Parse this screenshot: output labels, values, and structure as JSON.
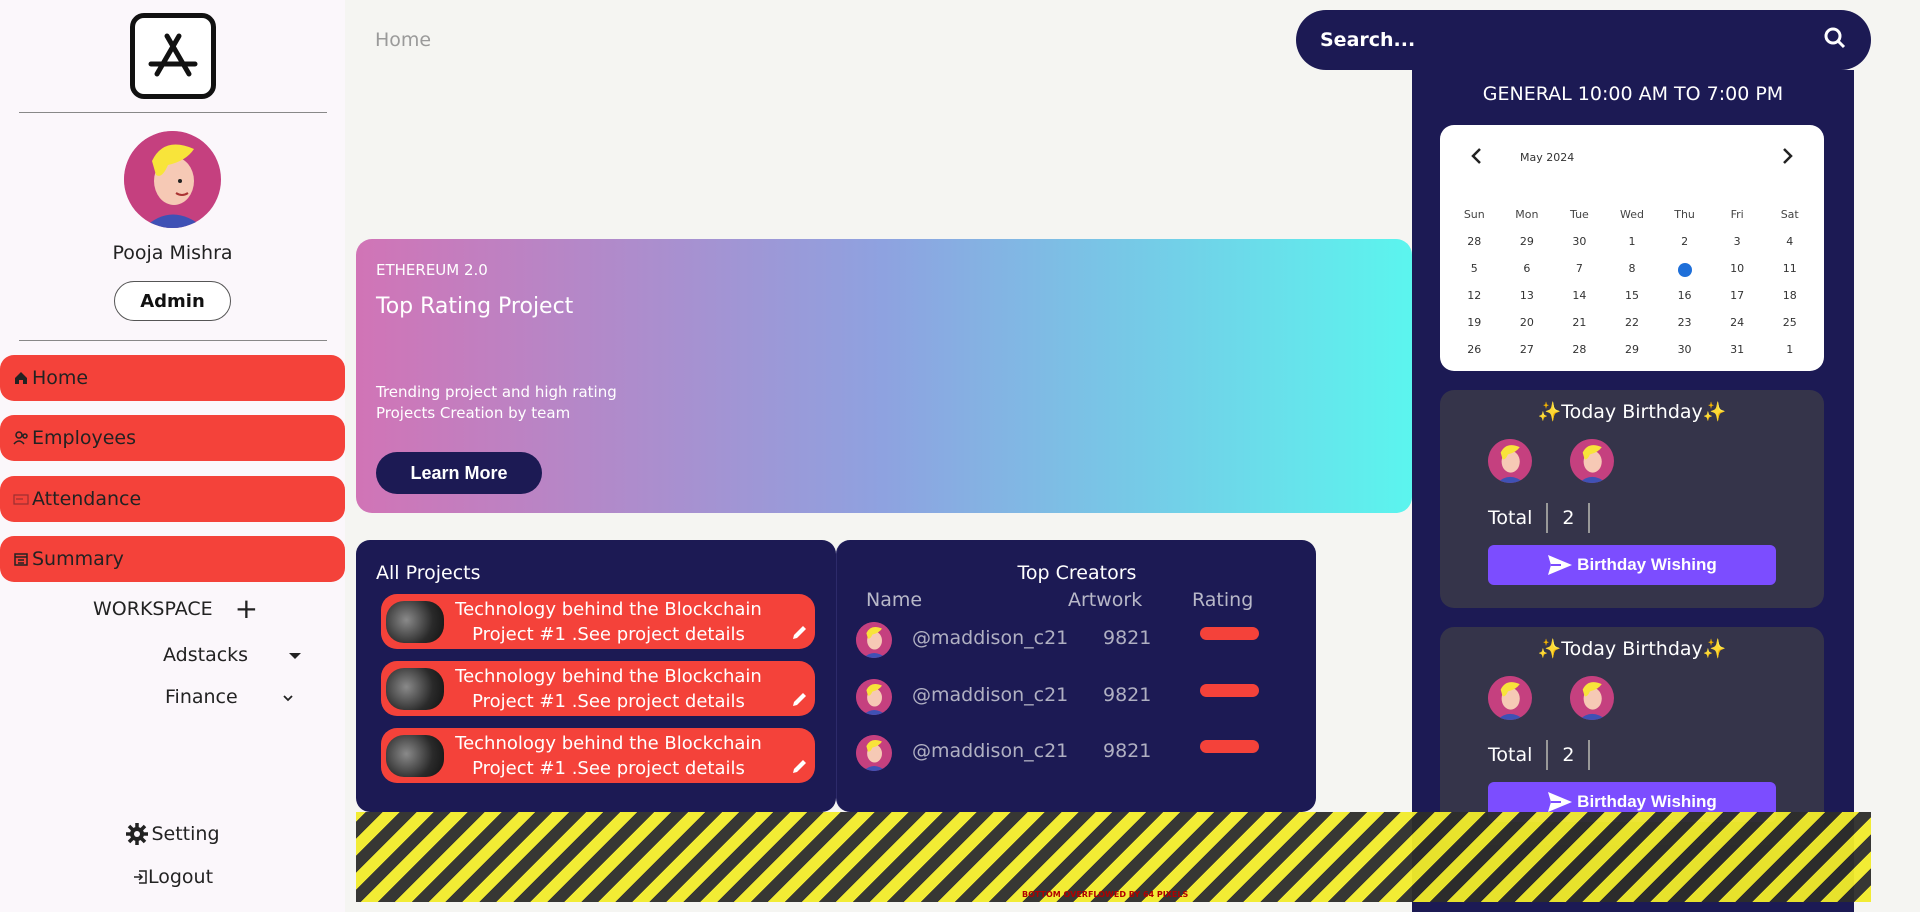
{
  "sidebar": {
    "logo_icon": "app-store-icon",
    "user": {
      "name": "Pooja Mishra",
      "role": "Admin"
    },
    "nav": [
      {
        "label": "Home",
        "icon": "home-icon"
      },
      {
        "label": "Employees",
        "icon": "users-icon"
      },
      {
        "label": "Attendance",
        "icon": "card-icon"
      },
      {
        "label": "Summary",
        "icon": "calendar-icon"
      }
    ],
    "workspace": {
      "label": "WORKSPACE",
      "add": "+",
      "items": [
        "Adstacks",
        "Finance"
      ]
    },
    "setting_label": "Setting",
    "logout_label": "Logout"
  },
  "header": {
    "breadcrumb": "Home",
    "search_placeholder": "Search..."
  },
  "banner": {
    "tag": "ETHEREUM 2.0",
    "title": "Top Rating Project",
    "subtitle": "Trending project and high rating Projects Creation by team",
    "button": "Learn More"
  },
  "projects": {
    "heading": "All Projects",
    "items": [
      {
        "text": "Technology behind the Blockchain Project #1 .See project details"
      },
      {
        "text": "Technology behind the Blockchain Project #1 .See project details"
      },
      {
        "text": "Technology behind the Blockchain Project #1 .See project details"
      }
    ]
  },
  "creators": {
    "heading": "Top Creators",
    "columns": [
      "Name",
      "Artwork",
      "Rating"
    ],
    "rows": [
      {
        "name": "@maddison_c21",
        "artwork": "9821"
      },
      {
        "name": "@maddison_c21",
        "artwork": "9821"
      },
      {
        "name": "@maddison_c21",
        "artwork": "9821"
      }
    ]
  },
  "right": {
    "shift": "GENERAL 10:00 AM TO 7:00 PM",
    "calendar": {
      "month": "May 2024",
      "days_of_week": [
        "Sun",
        "Mon",
        "Tue",
        "Wed",
        "Thu",
        "Fri",
        "Sat"
      ],
      "dates": [
        "28",
        "29",
        "30",
        "1",
        "2",
        "3",
        "4",
        "5",
        "6",
        "7",
        "8",
        "9",
        "10",
        "11",
        "12",
        "13",
        "14",
        "15",
        "16",
        "17",
        "18",
        "19",
        "20",
        "21",
        "22",
        "23",
        "24",
        "25",
        "26",
        "27",
        "28",
        "29",
        "30",
        "31",
        "1"
      ],
      "selected": "9"
    },
    "birthdays": [
      {
        "title": "✨Today Birthday✨",
        "total_label": "Total",
        "total": "2",
        "button": "Birthday Wishing"
      },
      {
        "title": "✨Today Birthday✨",
        "total_label": "Total",
        "total": "2",
        "button": "Birthday Wishing"
      }
    ]
  },
  "overflow_label": "BOTTOM OVERFLOWED BY 64 PIXELS",
  "colors": {
    "navy": "#1c1a54",
    "red": "#f4423a",
    "purple": "#7c4dff",
    "dark_card": "#35344a"
  }
}
